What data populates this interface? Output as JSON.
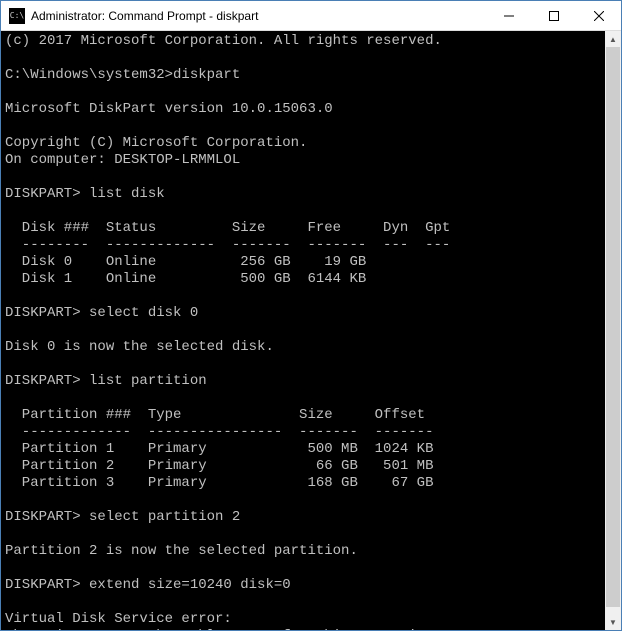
{
  "window": {
    "title": "Administrator: Command Prompt - diskpart",
    "icon_glyph": "C:\\"
  },
  "colors": {
    "terminal_bg": "#000000",
    "terminal_fg": "#c0c0c0",
    "border": "#4a7fb5"
  },
  "terminal": {
    "lines": [
      "(c) 2017 Microsoft Corporation. All rights reserved.",
      "",
      "C:\\Windows\\system32>diskpart",
      "",
      "Microsoft DiskPart version 10.0.15063.0",
      "",
      "Copyright (C) Microsoft Corporation.",
      "On computer: DESKTOP-LRMMLOL",
      "",
      "DISKPART> list disk",
      "",
      "  Disk ###  Status         Size     Free     Dyn  Gpt",
      "  --------  -------------  -------  -------  ---  ---",
      "  Disk 0    Online          256 GB    19 GB",
      "  Disk 1    Online          500 GB  6144 KB",
      "",
      "DISKPART> select disk 0",
      "",
      "Disk 0 is now the selected disk.",
      "",
      "DISKPART> list partition",
      "",
      "  Partition ###  Type              Size     Offset",
      "  -------------  ----------------  -------  -------",
      "  Partition 1    Primary            500 MB  1024 KB",
      "  Partition 2    Primary             66 GB   501 MB",
      "  Partition 3    Primary            168 GB    67 GB",
      "",
      "DISKPART> select partition 2",
      "",
      "Partition 2 is now the selected partition.",
      "",
      "DISKPART> extend size=10240 disk=0",
      "",
      "Virtual Disk Service error:",
      "There is not enough usable space for this operation."
    ]
  },
  "disks": [
    {
      "id": "Disk 0",
      "status": "Online",
      "size": "256 GB",
      "free": "19 GB",
      "dyn": "",
      "gpt": ""
    },
    {
      "id": "Disk 1",
      "status": "Online",
      "size": "500 GB",
      "free": "6144 KB",
      "dyn": "",
      "gpt": ""
    }
  ],
  "partitions": [
    {
      "id": "Partition 1",
      "type": "Primary",
      "size": "500 MB",
      "offset": "1024 KB"
    },
    {
      "id": "Partition 2",
      "type": "Primary",
      "size": "66 GB",
      "offset": "501 MB"
    },
    {
      "id": "Partition 3",
      "type": "Primary",
      "size": "168 GB",
      "offset": "67 GB"
    }
  ],
  "commands": {
    "initial": "diskpart",
    "list_disk": "list disk",
    "select_disk": "select disk 0",
    "list_partition": "list partition",
    "select_partition": "select partition 2",
    "extend": "extend size=10240 disk=0"
  },
  "diskpart": {
    "version": "10.0.15063.0",
    "computer": "DESKTOP-LRMMLOL",
    "copyright_year": "2017",
    "vendor": "Microsoft Corporation"
  },
  "error": {
    "title": "Virtual Disk Service error:",
    "message": "There is not enough usable space for this operation."
  }
}
